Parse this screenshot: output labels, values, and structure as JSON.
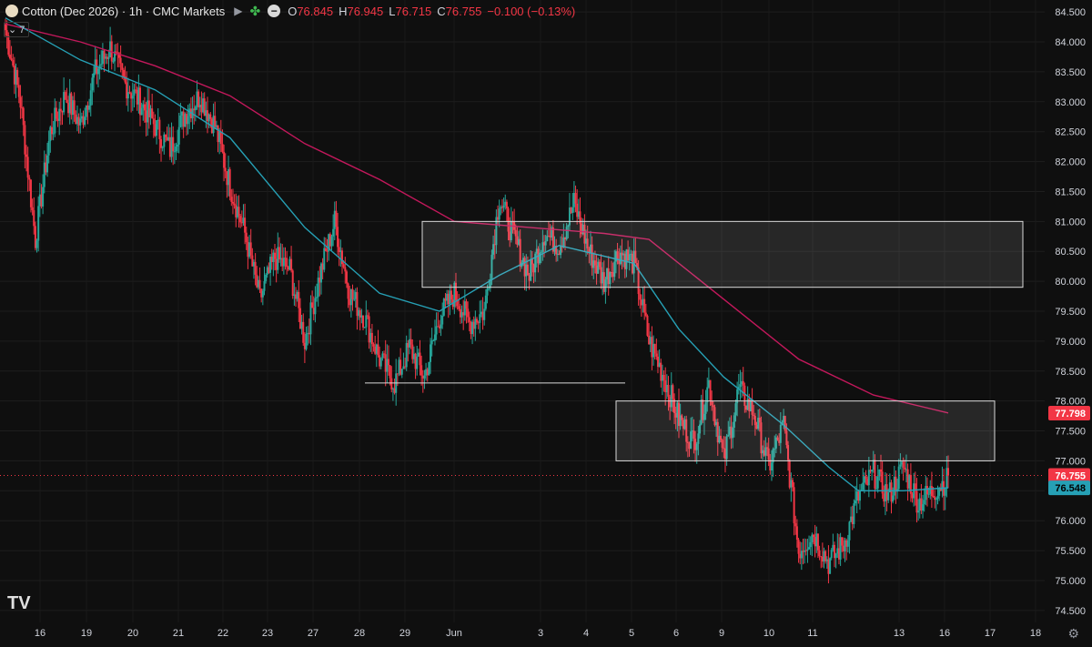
{
  "header": {
    "title": "Cotton (Dec 2026) · 1h · CMC Markets",
    "open_label": "O",
    "open": "76.845",
    "high_label": "H",
    "high": "76.945",
    "low_label": "L",
    "low": "76.715",
    "close_label": "C",
    "close": "76.755",
    "change": "−0.100 (−0.13%)"
  },
  "indicator_toggle": "7",
  "colors": {
    "background": "#0f0f0f",
    "up": "#26a69a",
    "down": "#f23645",
    "ema_fast": "#26a0b5",
    "ema_slow": "#c2185b",
    "zone_border": "#d9d9d9"
  },
  "chart_data": {
    "type": "candlestick",
    "timeframe": "1h",
    "x_ticks": [
      "16",
      "19",
      "20",
      "21",
      "22",
      "23",
      "27",
      "28",
      "29",
      "Jun",
      "3",
      "4",
      "5",
      "6",
      "9",
      "10",
      "11",
      "13",
      "16",
      "17",
      "18"
    ],
    "y_ticks": [
      "74.500",
      "75.000",
      "75.500",
      "76.000",
      "76.500",
      "77.000",
      "77.500",
      "78.000",
      "78.500",
      "79.000",
      "79.500",
      "80.000",
      "80.500",
      "81.000",
      "81.500",
      "82.000",
      "82.500",
      "83.000",
      "83.500",
      "84.000",
      "84.500"
    ],
    "ylim": [
      74.3,
      84.7
    ],
    "price_anchors": [
      [
        0,
        84.2
      ],
      [
        1,
        83.0
      ],
      [
        2,
        80.7
      ],
      [
        3,
        82.5
      ],
      [
        4,
        83.1
      ],
      [
        5,
        82.6
      ],
      [
        6,
        83.5
      ],
      [
        7,
        83.9
      ],
      [
        8,
        83.3
      ],
      [
        9,
        83.0
      ],
      [
        10,
        82.6
      ],
      [
        11,
        82.2
      ],
      [
        12,
        82.8
      ],
      [
        13,
        83.1
      ],
      [
        14,
        82.6
      ],
      [
        15,
        81.6
      ],
      [
        16,
        80.8
      ],
      [
        17,
        79.7
      ],
      [
        18,
        80.4
      ],
      [
        19,
        80.2
      ],
      [
        20,
        79.0
      ],
      [
        21,
        80.1
      ],
      [
        22,
        81.0
      ],
      [
        23,
        79.8
      ],
      [
        24,
        79.4
      ],
      [
        25,
        78.7
      ],
      [
        26,
        78.3
      ],
      [
        27,
        78.9
      ],
      [
        28,
        78.4
      ],
      [
        29,
        79.4
      ],
      [
        30,
        79.8
      ],
      [
        31,
        79.3
      ],
      [
        32,
        79.5
      ],
      [
        33,
        81.4
      ],
      [
        34,
        80.7
      ],
      [
        35,
        80.1
      ],
      [
        36,
        80.8
      ],
      [
        37,
        80.6
      ],
      [
        38,
        81.3
      ],
      [
        39,
        80.5
      ],
      [
        40,
        80.0
      ],
      [
        41,
        80.5
      ],
      [
        42,
        80.3
      ],
      [
        43,
        79.0
      ],
      [
        44,
        78.4
      ],
      [
        45,
        77.7
      ],
      [
        46,
        77.3
      ],
      [
        47,
        78.3
      ],
      [
        48,
        77.0
      ],
      [
        49,
        78.2
      ],
      [
        50,
        77.8
      ],
      [
        51,
        76.9
      ],
      [
        52,
        77.6
      ],
      [
        53,
        75.5
      ],
      [
        54,
        75.8
      ],
      [
        55,
        75.3
      ],
      [
        56,
        75.6
      ],
      [
        57,
        76.4
      ],
      [
        58,
        76.8
      ],
      [
        59,
        76.4
      ],
      [
        60,
        76.9
      ],
      [
        61,
        76.3
      ],
      [
        62,
        76.5
      ],
      [
        63,
        76.7
      ]
    ],
    "ema_fast": {
      "name": "EMA fast",
      "points": [
        [
          0,
          84.4
        ],
        [
          5,
          83.7
        ],
        [
          10,
          83.2
        ],
        [
          15,
          82.4
        ],
        [
          20,
          80.9
        ],
        [
          25,
          79.8
        ],
        [
          29,
          79.5
        ],
        [
          33,
          80.1
        ],
        [
          37,
          80.6
        ],
        [
          42,
          80.3
        ],
        [
          45,
          79.2
        ],
        [
          48,
          78.4
        ],
        [
          52,
          77.6
        ],
        [
          55,
          76.9
        ],
        [
          57,
          76.5
        ],
        [
          60,
          76.5
        ],
        [
          63,
          76.55
        ]
      ],
      "last_value": "76.548"
    },
    "ema_slow": {
      "name": "EMA slow",
      "points": [
        [
          0,
          84.3
        ],
        [
          5,
          84.0
        ],
        [
          10,
          83.6
        ],
        [
          15,
          83.1
        ],
        [
          20,
          82.3
        ],
        [
          25,
          81.7
        ],
        [
          30,
          81.0
        ],
        [
          35,
          80.9
        ],
        [
          40,
          80.8
        ],
        [
          43,
          80.7
        ],
        [
          48,
          79.7
        ],
        [
          53,
          78.7
        ],
        [
          58,
          78.1
        ],
        [
          63,
          77.8
        ]
      ],
      "last_value": "77.798"
    },
    "zones": [
      {
        "x0": 30,
        "x1": 72,
        "y0": 79.9,
        "y1": 81.0
      },
      {
        "x0": 44,
        "x1": 70,
        "y0": 77.0,
        "y1": 78.0
      }
    ],
    "support_line": {
      "x0": 25,
      "x1": 44,
      "y": 78.3
    },
    "last_price": "76.755",
    "last_price_value": 76.755
  }
}
